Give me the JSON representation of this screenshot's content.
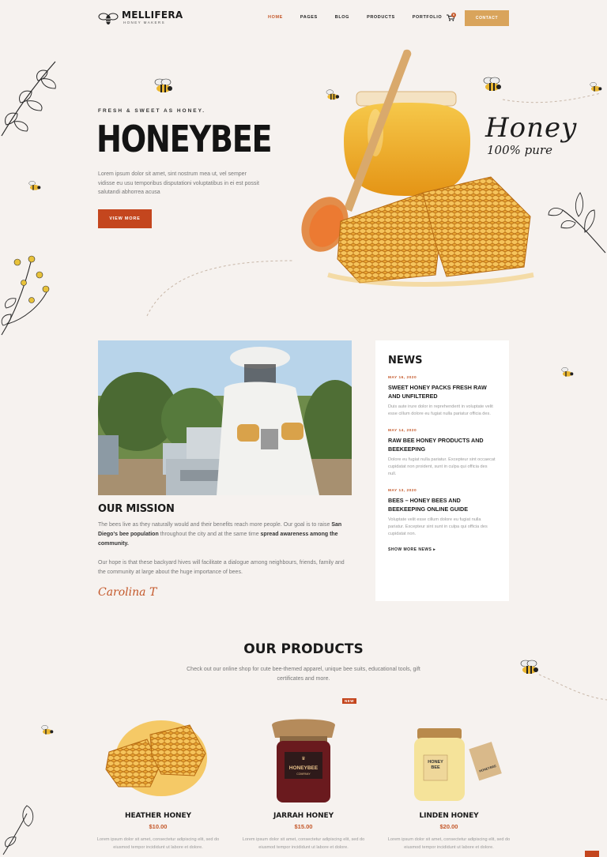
{
  "brand": {
    "name": "MELLIFERA",
    "tagline": "HONEY MAKERS"
  },
  "nav": {
    "items": [
      {
        "label": "HOME",
        "active": true
      },
      {
        "label": "PAGES",
        "active": false
      },
      {
        "label": "BLOG",
        "active": false
      },
      {
        "label": "PRODUCTS",
        "active": false
      },
      {
        "label": "PORTFOLIO",
        "active": false
      }
    ],
    "cart_count": "0",
    "contact_label": "CONTACT"
  },
  "hero": {
    "eyebrow": "FRESH & SWEET AS HONEY.",
    "title": "HONEYBEE",
    "text": "Lorem ipsum dolor sit amet, sint nostrum mea ut, vel semper vidisse eu usu temporibus disputationi voluptatibus in ei est possit salutandi abhorrea acusa",
    "button_label": "VIEW MORE",
    "script_title": "Honey",
    "script_sub": "100% pure"
  },
  "mission": {
    "title": "OUR MISSION",
    "p1_a": "The bees live as they naturally would and their benefits reach more people. Our goal is to raise ",
    "p1_b": "San Diego's bee population",
    "p1_c": " throughout the city and at the same time ",
    "p1_d": "spread awareness among the community.",
    "p2": "Our hope is that these backyard hives will facilitate a dialogue among neighbours, friends, family and the community at large about the huge importance of bees.",
    "signature": "Carolina T"
  },
  "news": {
    "title": "NEWS",
    "items": [
      {
        "date": "MAY 16, 2020",
        "headline": "SWEET HONEY PACKS FRESH RAW AND UNFILTERED",
        "excerpt": "Duis aute irure dolor in reprehenderit in voluptate velit esse cillum dolore eu fugiat nulla pariatur officia des."
      },
      {
        "date": "MAY 14, 2020",
        "headline": "RAW BEE HONEY PRODUCTS AND BEEKEEPING",
        "excerpt": "Dolore eu fugiat nulla pariatur. Excepteur sint occaecat cupidatat non proident, sunt in culpa qui officia des null."
      },
      {
        "date": "MAY 13, 2020",
        "headline": "BEES – HONEY BEES AND BEEKEEPING ONLINE GUIDE",
        "excerpt": "Voluptate velit esse cillum dolore eu fugiat nulla pariatur. Excepteur sint sunt in culpa qui officia des cupidatat non."
      }
    ],
    "more_label": "SHOW MORE NEWS"
  },
  "products": {
    "title": "OUR PRODUCTS",
    "text": "Check out our online shop for cute bee-themed apparel, unique bee suits, educational tools, gift certificates and more.",
    "new_badge": "NEW",
    "items": [
      {
        "name": "HEATHER HONEY",
        "price": "$10.00",
        "desc": "Lorem ipsum dolor sit amet, consectetur adipiscing elit, sed do eiusmod tempor incididunt ut labore et dolore."
      },
      {
        "name": "JARRAH HONEY",
        "price": "$15.00",
        "desc": "Lorem ipsum dolor sit amet, consectetur adipiscing elit, sed do eiusmod tempor incididunt ut labore et dolore."
      },
      {
        "name": "LINDEN HONEY",
        "price": "$20.00",
        "desc": "Lorem ipsum dolor sit amet, consectetur adipiscing elit, sed do eiusmod tempor incididunt ut labore et dolore."
      }
    ],
    "jar_label_1": "HONEYBEE",
    "jar_label_2": "COMPANY",
    "jar2_label_1": "HONEY",
    "jar2_label_2": "BEE",
    "tag_label": "HONEYBEE"
  },
  "colors": {
    "accent": "#c4582a",
    "button": "#c4461e",
    "gold": "#d9a45b",
    "background": "#f6f2ef"
  },
  "icons": [
    "bee-logo-icon",
    "cart-icon",
    "arrow-right-icon"
  ]
}
